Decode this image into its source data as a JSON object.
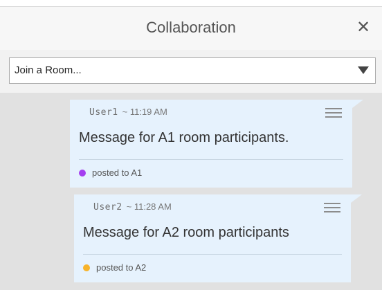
{
  "header": {
    "title": "Collaboration",
    "close_glyph": "✕",
    "close_icon": "close-icon"
  },
  "room_select": {
    "value": "Join a Room...",
    "arrow_icon": "caret-down-icon"
  },
  "messages": [
    {
      "user": "User1",
      "time": "~ 11:19 AM",
      "text": "Message for A1 room participants.",
      "posted": "posted to A1",
      "room_color": "#a43ef0",
      "menu_icon": "menu-icon"
    },
    {
      "user": "User2",
      "time": "~ 11:28 AM",
      "text": "Message for A2 room participants",
      "posted": "posted to A2",
      "room_color": "#f7b32b",
      "menu_icon": "menu-icon"
    }
  ],
  "colors": {
    "feed_background": "#e1e1e1",
    "bubble_background": "#e6f2fd"
  }
}
